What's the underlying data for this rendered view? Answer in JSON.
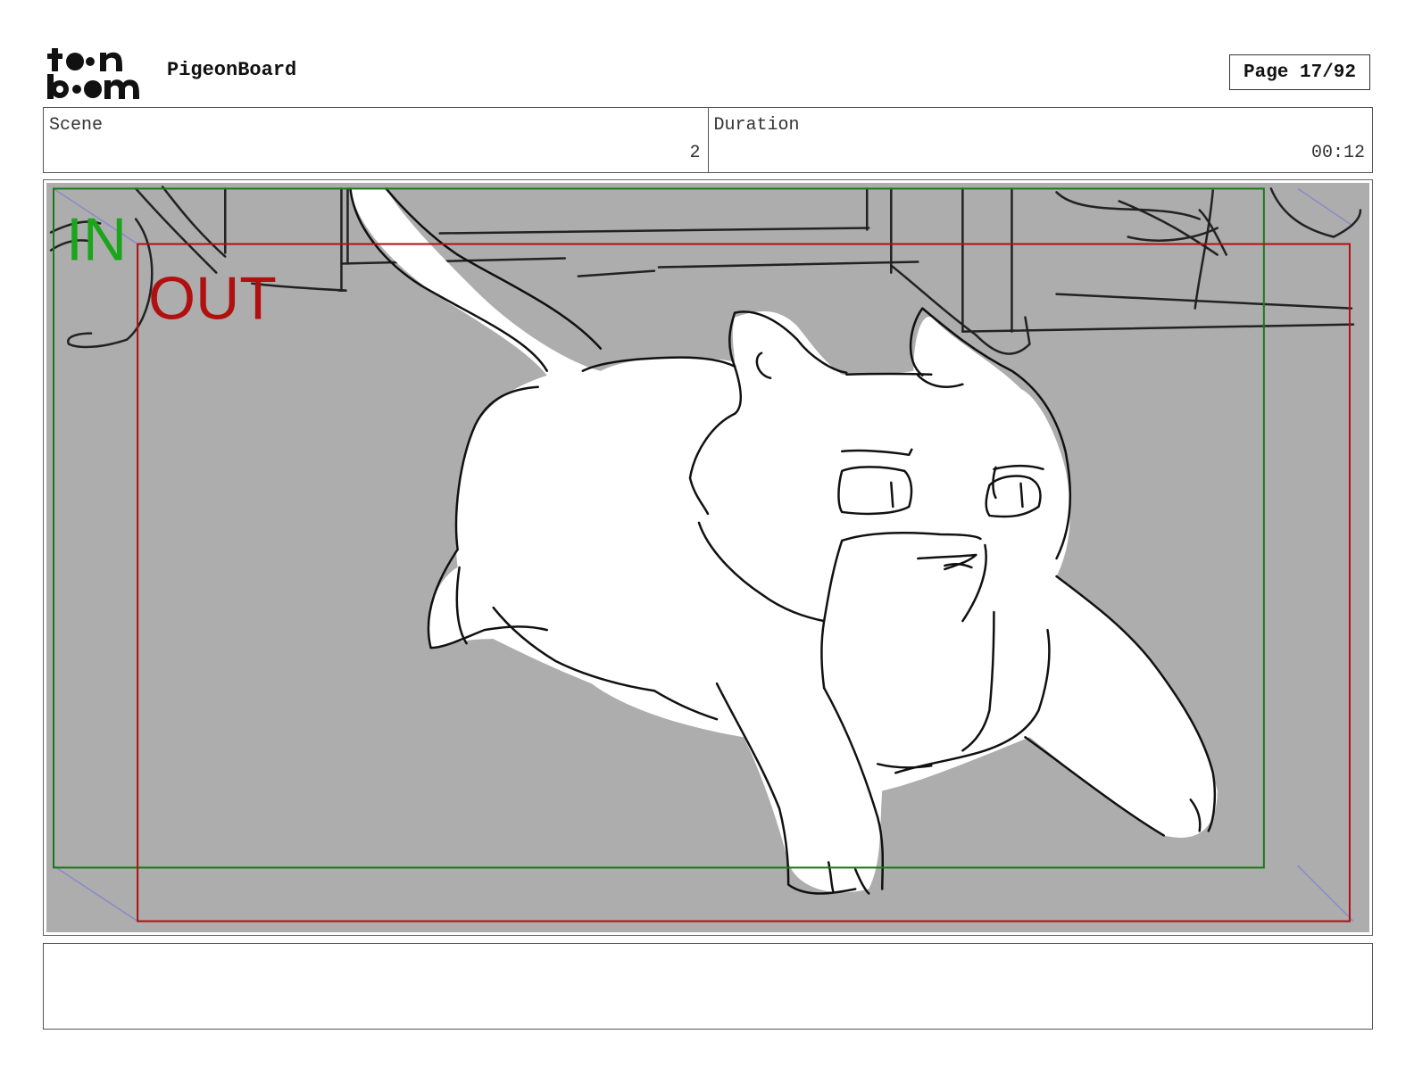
{
  "header": {
    "logo_name": "toonboom-logo",
    "app_title": "PigeonBoard",
    "page_label": "Page 17/92"
  },
  "info": {
    "scene_label": "Scene",
    "scene_value": "2",
    "duration_label": "Duration",
    "duration_value": "00:12"
  },
  "panel": {
    "in_label": "IN",
    "out_label": "OUT",
    "in_color": "#1aa51a",
    "out_color": "#b01010",
    "background_color": "#adadad"
  },
  "caption": {
    "text": ""
  }
}
